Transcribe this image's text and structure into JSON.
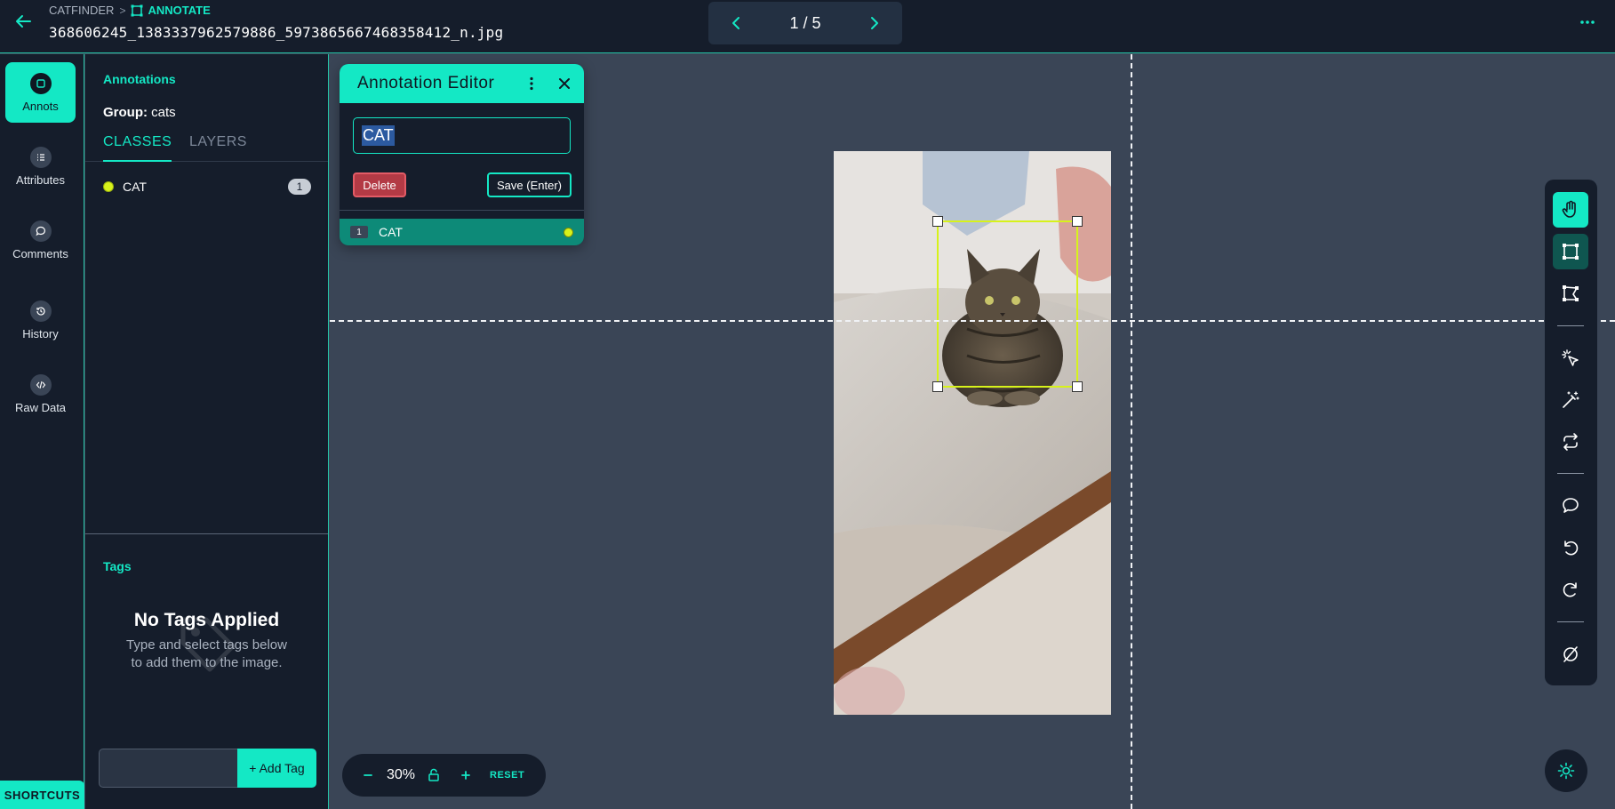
{
  "header": {
    "breadcrumb_project": "CATFINDER",
    "breadcrumb_separator": ">",
    "breadcrumb_current": "ANNOTATE",
    "filename": "368606245_1383337962579886_5973865667468358412_n.jpg",
    "pager": "1 / 5",
    "icons": [
      "back-arrow-icon",
      "annotate-icon",
      "chevron-left-icon",
      "chevron-right-icon",
      "more-horizontal-icon"
    ]
  },
  "nav": {
    "items": [
      {
        "label": "Annots",
        "icon": "annotation-icon",
        "active": true
      },
      {
        "label": "Attributes",
        "icon": "list-icon",
        "active": false
      },
      {
        "label": "Comments",
        "icon": "comment-icon",
        "active": false
      },
      {
        "label": "History",
        "icon": "history-icon",
        "active": false
      },
      {
        "label": "Raw Data",
        "icon": "code-icon",
        "active": false
      }
    ],
    "shortcuts": "SHORTCUTS"
  },
  "panel": {
    "title": "Annotations",
    "group_label": "Group:",
    "group_value": "cats",
    "tabs": [
      "CLASSES",
      "LAYERS"
    ],
    "active_tab": "CLASSES",
    "classes": [
      {
        "name": "CAT",
        "count": "1",
        "color": "#d7f21b"
      }
    ]
  },
  "tags": {
    "title": "Tags",
    "empty_title": "No Tags Applied",
    "empty_sub": "Type and select tags below to add them to the image.",
    "input_value": "",
    "add_label": "+ Add Tag"
  },
  "editor": {
    "title": "Annotation Editor",
    "input_value": "CAT",
    "delete_label": "Delete",
    "save_label": "Save (Enter)",
    "rows": [
      {
        "index": "1",
        "name": "CAT",
        "color": "#d7f21b"
      }
    ]
  },
  "zoom": {
    "value": "30%",
    "reset_label": "RESET"
  },
  "toolbar": {
    "tools": [
      "pan-hand-icon",
      "bounding-box-icon",
      "polygon-icon",
      "smart-select-icon",
      "magic-wand-icon",
      "repeat-icon",
      "comment-icon",
      "undo-icon",
      "redo-icon",
      "hide-icon"
    ],
    "active_tool": "pan-hand-icon"
  },
  "colors": {
    "accent": "#14e8c5",
    "annotation": "#d7f21b",
    "background": "#3a4556",
    "panel": "#151d2b"
  }
}
